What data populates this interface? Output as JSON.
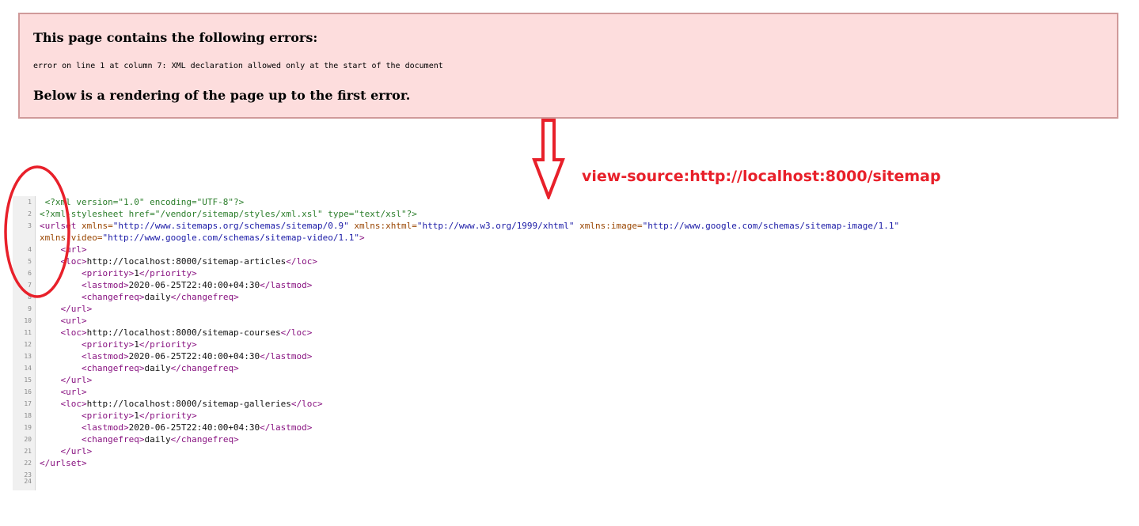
{
  "error_box": {
    "heading": "This page contains the following errors:",
    "detail": "error on line 1 at column 7: XML declaration allowed only at the start of the document",
    "footer": "Below is a rendering of the page up to the first error."
  },
  "annotation": {
    "source_url": "view-source:http://localhost:8000/sitemap",
    "accent_color": "#e8202a"
  },
  "source": {
    "lines": [
      {
        "n": "1",
        "i": 1,
        "parts": [
          {
            "c": "t-pi",
            "t": "<?xml version=\"1.0\" encoding=\"UTF-8\"?>"
          }
        ]
      },
      {
        "n": "2",
        "i": 0,
        "parts": [
          {
            "c": "t-pi",
            "t": "<?xml-stylesheet href=\"/vendor/sitemap/styles/xml.xsl\" type=\"text/xsl\"?>"
          }
        ]
      },
      {
        "n": "3",
        "i": 0,
        "parts": [
          {
            "c": "t-tag",
            "t": "<urlset "
          },
          {
            "c": "t-attr",
            "t": "xmlns="
          },
          {
            "c": "t-val",
            "t": "\"http://www.sitemaps.org/schemas/sitemap/0.9\" "
          },
          {
            "c": "t-attr",
            "t": "xmlns:xhtml="
          },
          {
            "c": "t-val",
            "t": "\"http://www.w3.org/1999/xhtml\" "
          },
          {
            "c": "t-attr",
            "t": "xmlns:image="
          },
          {
            "c": "t-val",
            "t": "\"http://www.google.com/schemas/sitemap-image/1.1\""
          }
        ]
      },
      {
        "n": "",
        "i": 0,
        "parts": [
          {
            "c": "t-attr",
            "t": "xmlns:video="
          },
          {
            "c": "t-val",
            "t": "\"http://www.google.com/schemas/sitemap-video/1.1\""
          },
          {
            "c": "t-tag",
            "t": ">"
          }
        ]
      },
      {
        "n": "4",
        "i": 4,
        "parts": [
          {
            "c": "t-tag",
            "t": "<url>"
          }
        ]
      },
      {
        "n": "5",
        "i": 4,
        "parts": [
          {
            "c": "t-tag",
            "t": "<loc>"
          },
          {
            "c": "t-plain",
            "t": "http://localhost:8000/sitemap-articles"
          },
          {
            "c": "t-tag",
            "t": "</loc>"
          }
        ]
      },
      {
        "n": "6",
        "i": 8,
        "parts": [
          {
            "c": "t-tag",
            "t": "<priority>"
          },
          {
            "c": "t-plain",
            "t": "1"
          },
          {
            "c": "t-tag",
            "t": "</priority>"
          }
        ]
      },
      {
        "n": "7",
        "i": 8,
        "parts": [
          {
            "c": "t-tag",
            "t": "<lastmod>"
          },
          {
            "c": "t-plain",
            "t": "2020-06-25T22:40:00+04:30"
          },
          {
            "c": "t-tag",
            "t": "</lastmod>"
          }
        ]
      },
      {
        "n": "8",
        "i": 8,
        "parts": [
          {
            "c": "t-tag",
            "t": "<changefreq>"
          },
          {
            "c": "t-plain",
            "t": "daily"
          },
          {
            "c": "t-tag",
            "t": "</changefreq>"
          }
        ]
      },
      {
        "n": "9",
        "i": 4,
        "parts": [
          {
            "c": "t-tag",
            "t": "</url>"
          }
        ]
      },
      {
        "n": "10",
        "i": 4,
        "parts": [
          {
            "c": "t-tag",
            "t": "<url>"
          }
        ]
      },
      {
        "n": "11",
        "i": 4,
        "parts": [
          {
            "c": "t-tag",
            "t": "<loc>"
          },
          {
            "c": "t-plain",
            "t": "http://localhost:8000/sitemap-courses"
          },
          {
            "c": "t-tag",
            "t": "</loc>"
          }
        ]
      },
      {
        "n": "12",
        "i": 8,
        "parts": [
          {
            "c": "t-tag",
            "t": "<priority>"
          },
          {
            "c": "t-plain",
            "t": "1"
          },
          {
            "c": "t-tag",
            "t": "</priority>"
          }
        ]
      },
      {
        "n": "13",
        "i": 8,
        "parts": [
          {
            "c": "t-tag",
            "t": "<lastmod>"
          },
          {
            "c": "t-plain",
            "t": "2020-06-25T22:40:00+04:30"
          },
          {
            "c": "t-tag",
            "t": "</lastmod>"
          }
        ]
      },
      {
        "n": "14",
        "i": 8,
        "parts": [
          {
            "c": "t-tag",
            "t": "<changefreq>"
          },
          {
            "c": "t-plain",
            "t": "daily"
          },
          {
            "c": "t-tag",
            "t": "</changefreq>"
          }
        ]
      },
      {
        "n": "15",
        "i": 4,
        "parts": [
          {
            "c": "t-tag",
            "t": "</url>"
          }
        ]
      },
      {
        "n": "16",
        "i": 4,
        "parts": [
          {
            "c": "t-tag",
            "t": "<url>"
          }
        ]
      },
      {
        "n": "17",
        "i": 4,
        "parts": [
          {
            "c": "t-tag",
            "t": "<loc>"
          },
          {
            "c": "t-plain",
            "t": "http://localhost:8000/sitemap-galleries"
          },
          {
            "c": "t-tag",
            "t": "</loc>"
          }
        ]
      },
      {
        "n": "18",
        "i": 8,
        "parts": [
          {
            "c": "t-tag",
            "t": "<priority>"
          },
          {
            "c": "t-plain",
            "t": "1"
          },
          {
            "c": "t-tag",
            "t": "</priority>"
          }
        ]
      },
      {
        "n": "19",
        "i": 8,
        "parts": [
          {
            "c": "t-tag",
            "t": "<lastmod>"
          },
          {
            "c": "t-plain",
            "t": "2020-06-25T22:40:00+04:30"
          },
          {
            "c": "t-tag",
            "t": "</lastmod>"
          }
        ]
      },
      {
        "n": "20",
        "i": 8,
        "parts": [
          {
            "c": "t-tag",
            "t": "<changefreq>"
          },
          {
            "c": "t-plain",
            "t": "daily"
          },
          {
            "c": "t-tag",
            "t": "</changefreq>"
          }
        ]
      },
      {
        "n": "21",
        "i": 4,
        "parts": [
          {
            "c": "t-tag",
            "t": "</url>"
          }
        ]
      },
      {
        "n": "22",
        "i": 0,
        "parts": [
          {
            "c": "t-tag",
            "t": "</urlset>"
          }
        ]
      },
      {
        "n": "23",
        "i": 0,
        "short": true,
        "parts": []
      },
      {
        "n": "24",
        "i": 0,
        "short": true,
        "parts": []
      }
    ]
  }
}
